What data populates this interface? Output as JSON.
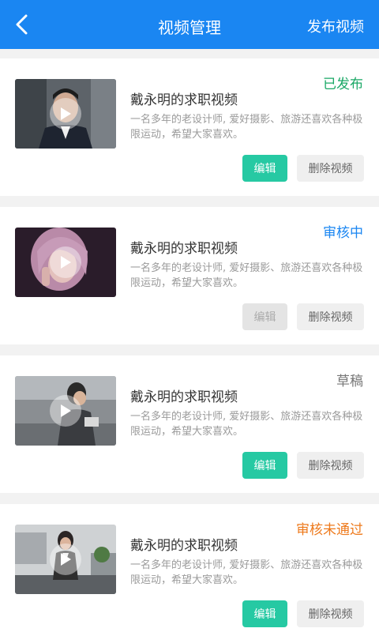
{
  "header": {
    "title": "视频管理",
    "action_label": "发布视频",
    "bg_color": "#1a86f2"
  },
  "icons": {
    "back": "chevron-left-icon",
    "play": "play-icon"
  },
  "colors": {
    "published": "#1aa866",
    "reviewing": "#1a86f2",
    "draft": "#777777",
    "rejected": "#ee7a1c",
    "edit": "#26c9a3"
  },
  "videos": [
    {
      "status": "已发布",
      "title": "戴永明的求职视频",
      "desc": "一名多年的老设计师, 爱好摄影、旅游还喜欢各种极限运动，希望大家喜欢。",
      "edit_label": "编辑",
      "delete_label": "删除视频",
      "edit_enabled": true
    },
    {
      "status": "审核中",
      "title": "戴永明的求职视频",
      "desc": "一名多年的老设计师, 爱好摄影、旅游还喜欢各种极限运动，希望大家喜欢。",
      "edit_label": "编辑",
      "delete_label": "删除视频",
      "edit_enabled": false
    },
    {
      "status": "草稿",
      "title": "戴永明的求职视频",
      "desc": "一名多年的老设计师, 爱好摄影、旅游还喜欢各种极限运动，希望大家喜欢。",
      "edit_label": "编辑",
      "delete_label": "删除视频",
      "edit_enabled": true
    },
    {
      "status": "审核未通过",
      "title": "戴永明的求职视频",
      "desc": "一名多年的老设计师, 爱好摄影、旅游还喜欢各种极限运动，希望大家喜欢。",
      "edit_label": "编辑",
      "delete_label": "删除视频",
      "edit_enabled": true
    }
  ]
}
